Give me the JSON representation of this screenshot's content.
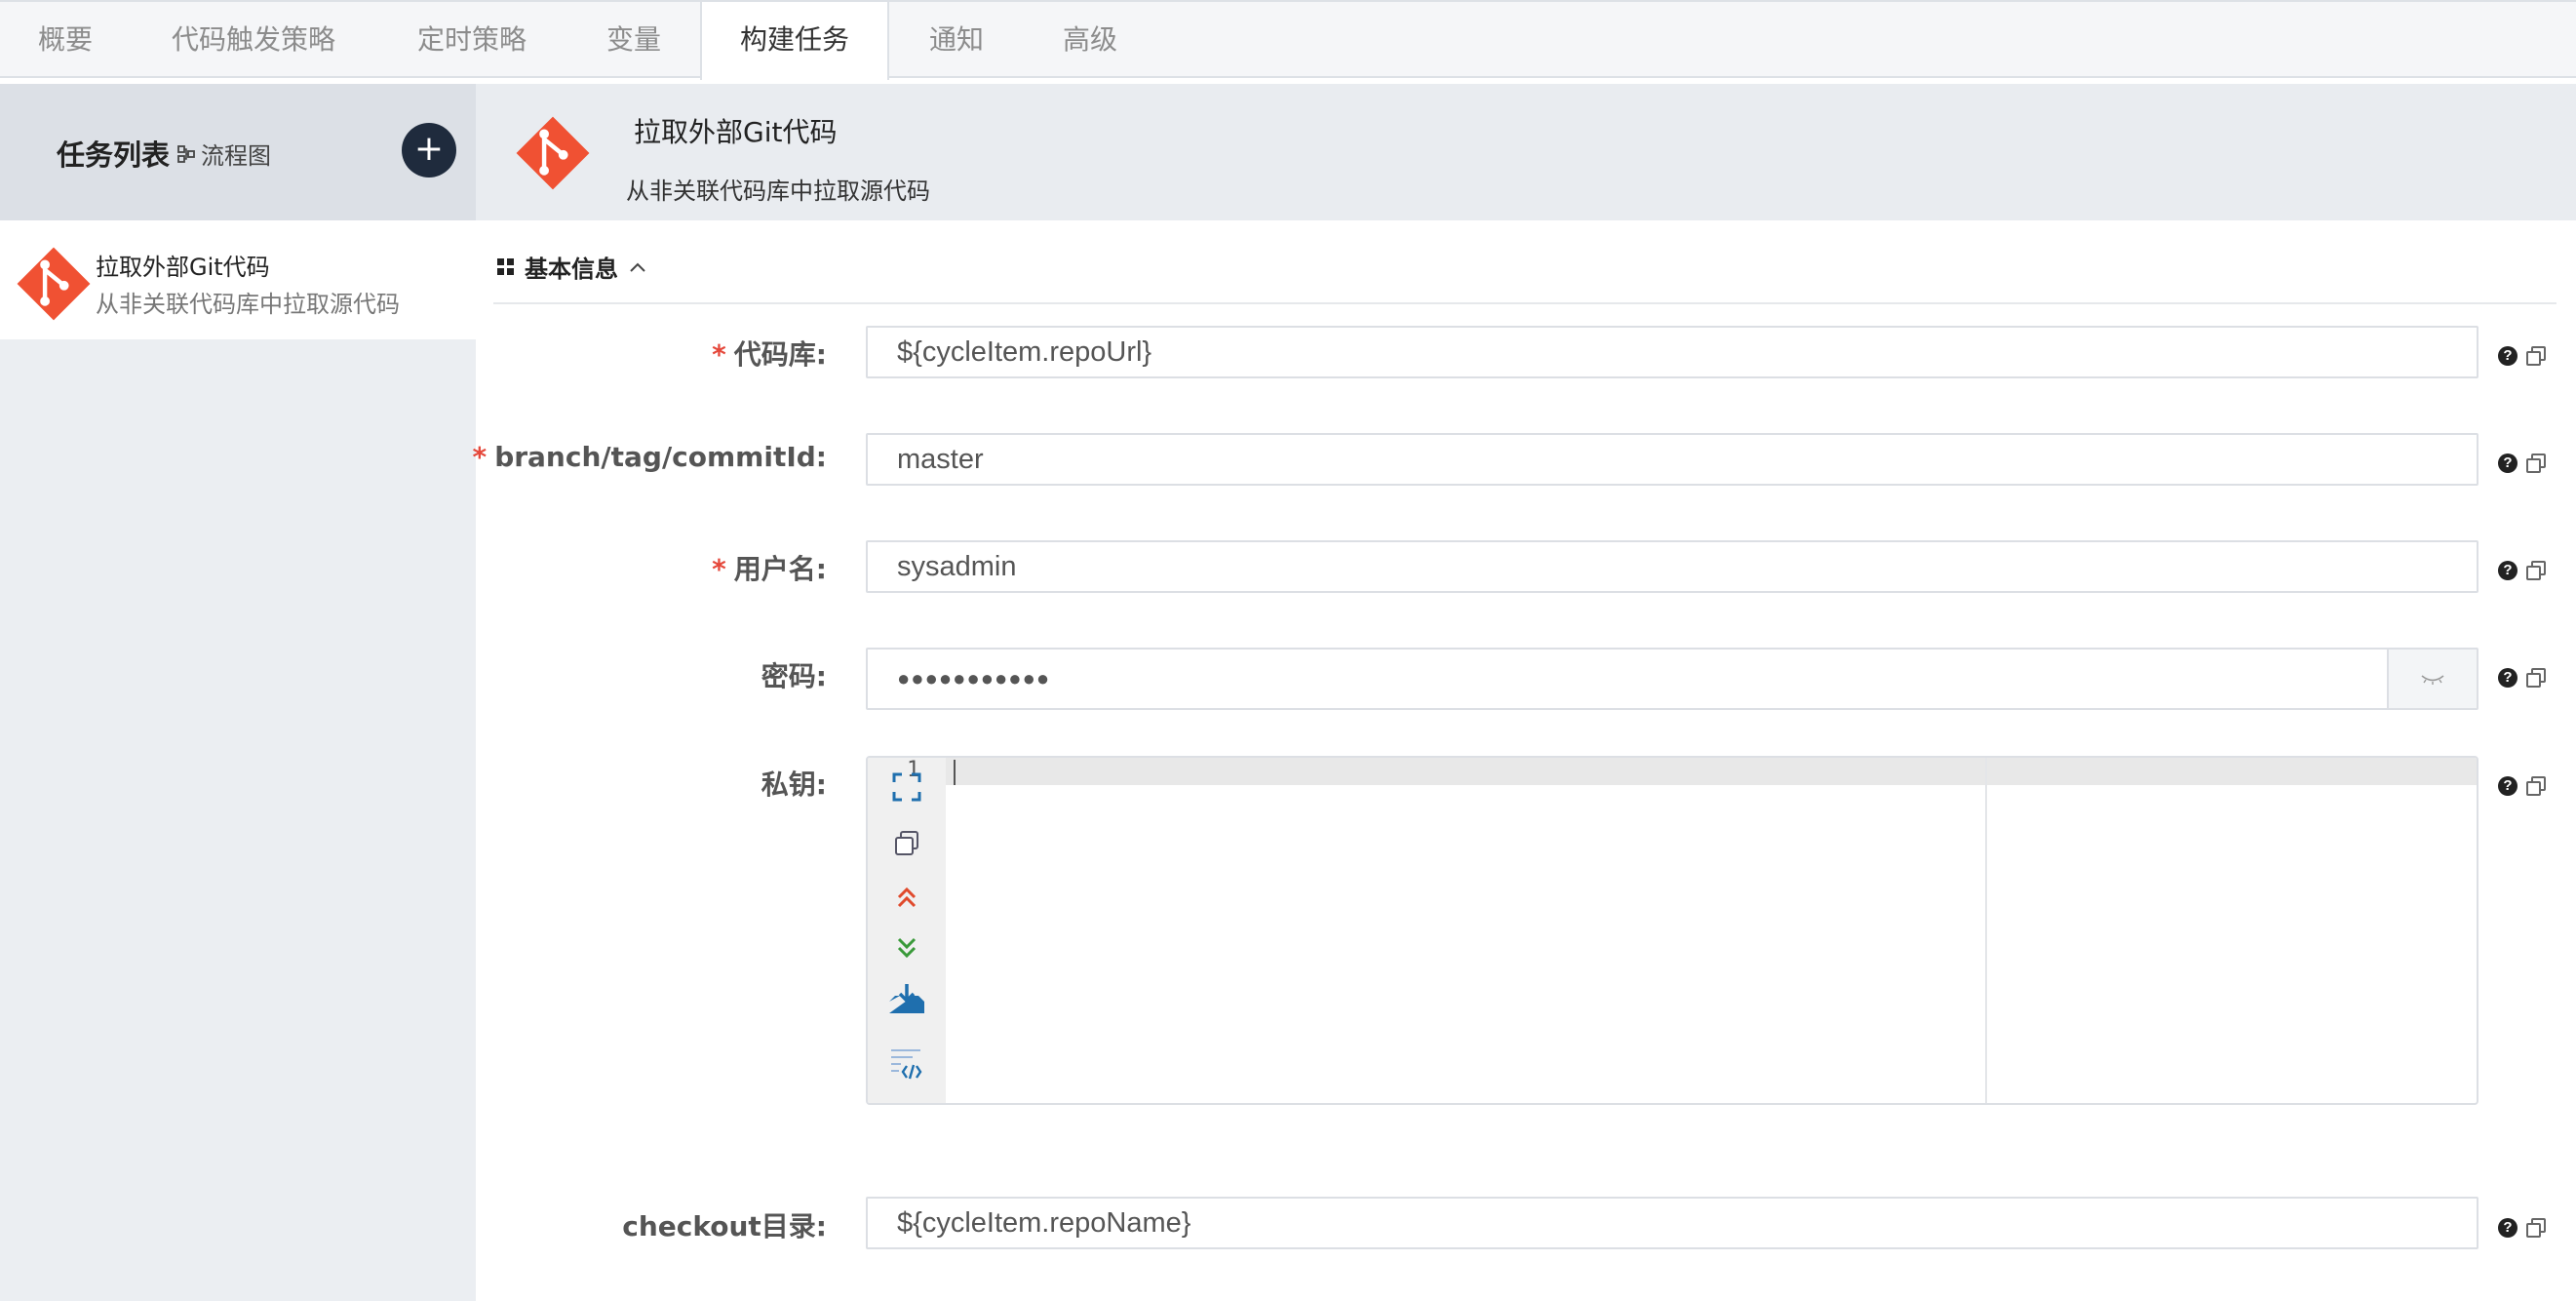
{
  "tabs": [
    {
      "label": "概要"
    },
    {
      "label": "代码触发策略"
    },
    {
      "label": "定时策略"
    },
    {
      "label": "变量"
    },
    {
      "label": "构建任务",
      "active": true
    },
    {
      "label": "通知"
    },
    {
      "label": "高级"
    }
  ],
  "left_panel": {
    "title": "任务列表",
    "flow_link": "流程图",
    "add_icon": "plus-icon",
    "tasks": [
      {
        "name": "拉取外部Git代码",
        "desc": "从非关联代码库中拉取源代码",
        "icon": "git-icon"
      }
    ]
  },
  "task_header": {
    "icon": "git-icon",
    "title": "拉取外部Git代码",
    "desc": "从非关联代码库中拉取源代码"
  },
  "section": {
    "title": "基本信息",
    "toggle_icon": "chevron-up-icon"
  },
  "form": {
    "repo": {
      "label": "代码库:",
      "required": "*",
      "value": "${cycleItem.repoUrl}"
    },
    "branch": {
      "label": "branch/tag/commitId:",
      "required": "*",
      "value": "master"
    },
    "username": {
      "label": "用户名:",
      "required": "*",
      "value": "sysadmin"
    },
    "password": {
      "label": "密码:",
      "value": "●●●●●●●●●●●"
    },
    "private_key": {
      "label": "私钥:",
      "line_number": "1",
      "value": ""
    },
    "checkout_dir": {
      "label": "checkout目录:",
      "value": "${cycleItem.repoName}"
    }
  },
  "colors": {
    "accent_dark": "#1f2b3d",
    "git_orange": "#f05133",
    "required_red": "#e5483b"
  }
}
